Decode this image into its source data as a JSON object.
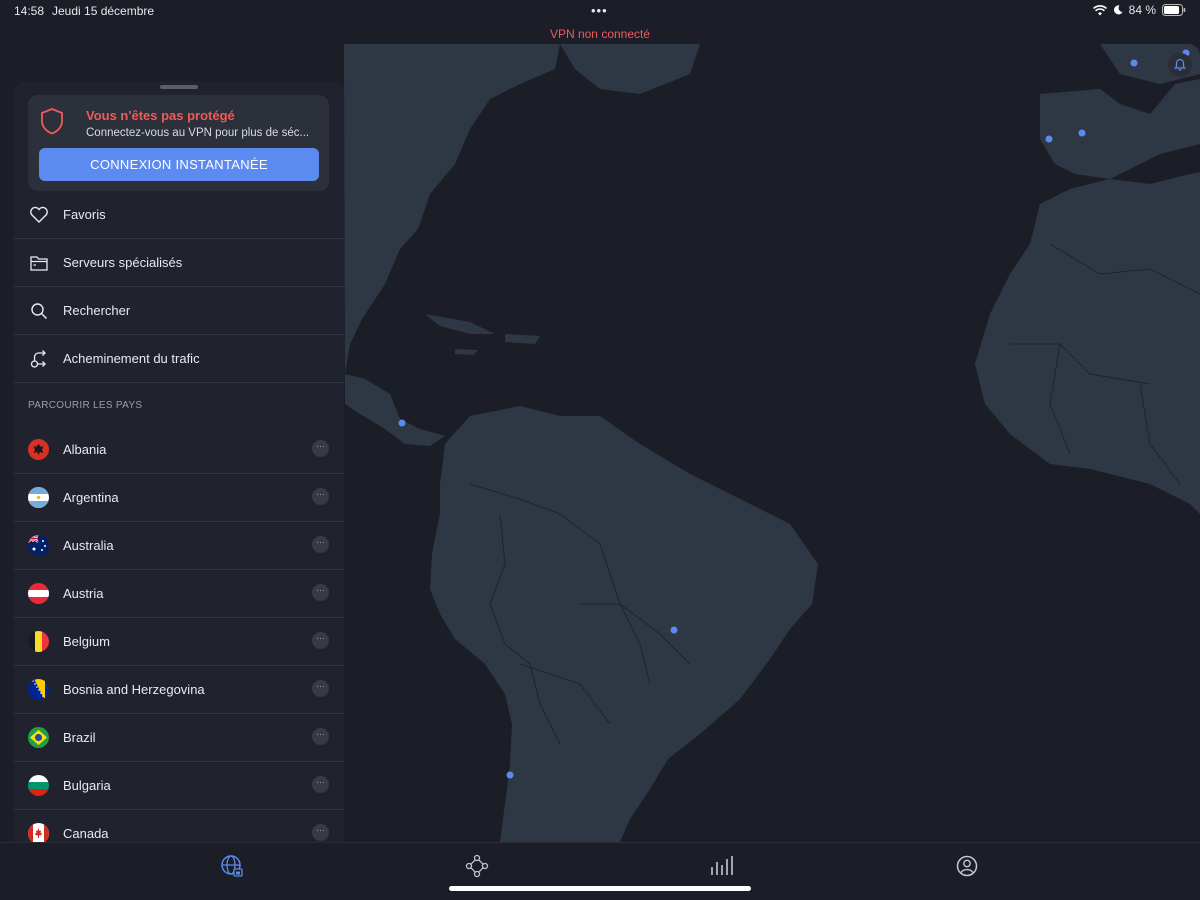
{
  "status_bar": {
    "time": "14:58",
    "date": "Jeudi 15 décembre",
    "battery": "84 %"
  },
  "vpn_status": "VPN non connecté",
  "protection_card": {
    "title": "Vous n'êtes pas protégé",
    "subtitle": "Connectez-vous au VPN pour plus de séc...",
    "button_label": "CONNEXION INSTANTANÉE"
  },
  "menu": [
    {
      "label": "Favoris",
      "icon": "heart-icon"
    },
    {
      "label": "Serveurs spécialisés",
      "icon": "folder-icon"
    },
    {
      "label": "Rechercher",
      "icon": "search-icon"
    },
    {
      "label": "Acheminement du trafic",
      "icon": "routing-icon"
    }
  ],
  "countries_header": "PARCOURIR LES PAYS",
  "countries": [
    {
      "name": "Albania"
    },
    {
      "name": "Argentina"
    },
    {
      "name": "Australia"
    },
    {
      "name": "Austria"
    },
    {
      "name": "Belgium"
    },
    {
      "name": "Bosnia and Herzegovina"
    },
    {
      "name": "Brazil"
    },
    {
      "name": "Bulgaria"
    },
    {
      "name": "Canada"
    }
  ],
  "country_more_label": "···",
  "tabs": [
    {
      "name": "globe-lock-icon",
      "active": true
    },
    {
      "name": "meshnet-icon",
      "active": false
    },
    {
      "name": "stats-icon",
      "active": false
    },
    {
      "name": "profile-icon",
      "active": false
    }
  ],
  "colors": {
    "accent": "#5b8af0",
    "danger": "#ef5a5a",
    "panel": "#20232d",
    "ocean": "#1b1e27",
    "land": "#2e3844"
  }
}
